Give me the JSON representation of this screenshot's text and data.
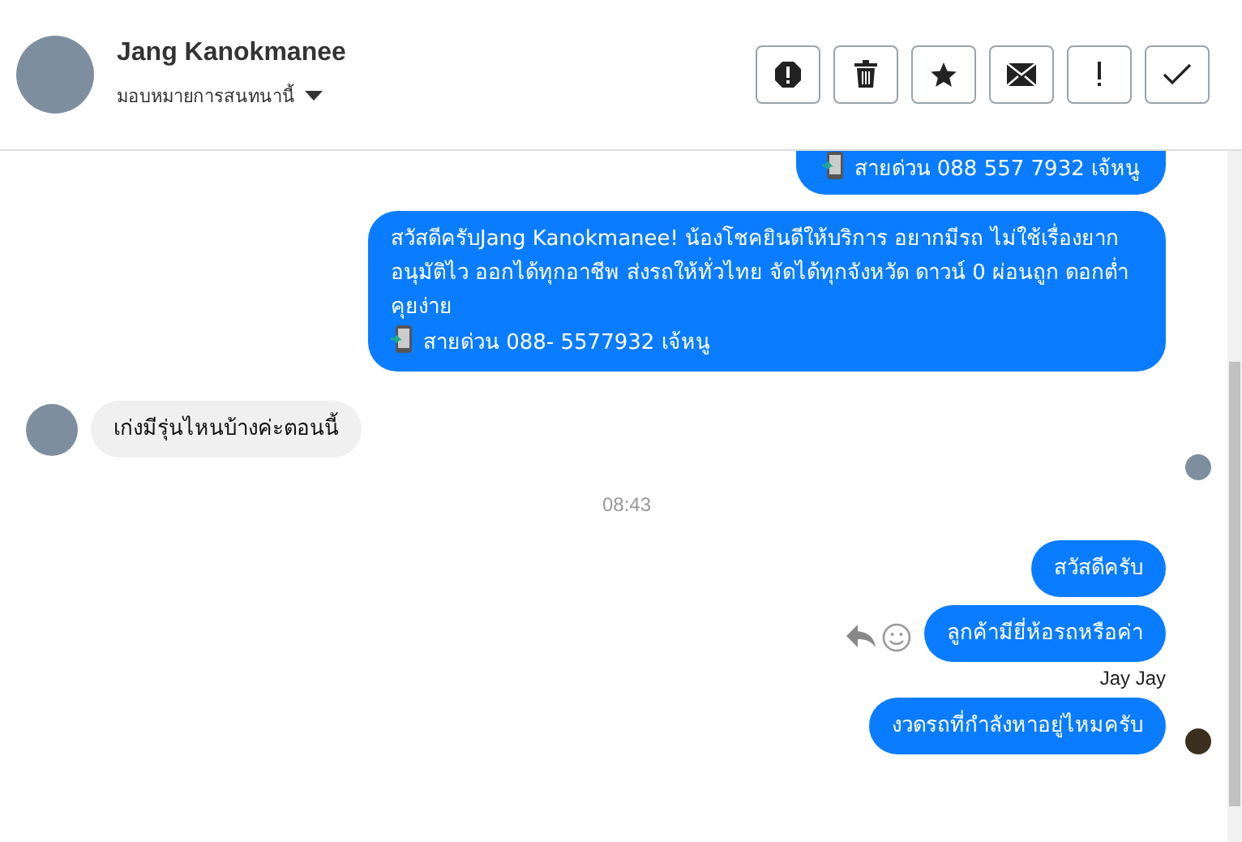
{
  "header": {
    "name": "Jang Kanokmanee",
    "assign_label": "มอบหมายการสนทนานี้"
  },
  "messages": [
    {
      "kind": "outgoing",
      "cut_top": true,
      "actions": false,
      "seen": false,
      "lines": [
        {
          "phone_icon": true,
          "text": "สายด่วน 088 557 7932 เจ้หนู"
        }
      ]
    },
    {
      "kind": "outgoing",
      "cut_top": false,
      "actions": false,
      "seen": false,
      "lines": [
        {
          "phone_icon": false,
          "text": "สวัสดีครับJang Kanokmanee! น้องโชคยินดีให้บริการ อยากมีรถ ไม่ใช้เรื่องยาก"
        },
        {
          "phone_icon": false,
          "text": "อนุมัติไว ออกได้ทุกอาชีพ ส่งรถให้ทั่วไทย จัดได้ทุกจังหวัด ดาวน์ 0  ผ่อนถูก ดอกต่ำ คุยง่าย"
        },
        {
          "phone_icon": true,
          "text": "สายด่วน 088- 5577932 เจ้หนู"
        }
      ]
    },
    {
      "kind": "incoming",
      "text": "เก่งมีรุ่นไหนบ้างค่ะตอนนี้",
      "seen": true
    },
    {
      "kind": "time",
      "text": "08:43"
    },
    {
      "kind": "outgoing",
      "cut_top": false,
      "actions": false,
      "seen": false,
      "lines": [
        {
          "phone_icon": false,
          "text": "สวัสดีครับ"
        }
      ]
    },
    {
      "kind": "outgoing",
      "cut_top": false,
      "actions": true,
      "seen": false,
      "lines": [
        {
          "phone_icon": false,
          "text": "ลูกค้ามียี่ห้อรถหรือค่า"
        }
      ]
    },
    {
      "kind": "sender",
      "text": "Jay Jay"
    },
    {
      "kind": "outgoing",
      "cut_top": false,
      "actions": false,
      "seen": true,
      "lines": [
        {
          "phone_icon": false,
          "text": "งวดรถที่กำลังหาอยู่ไหมครับ"
        }
      ]
    }
  ]
}
